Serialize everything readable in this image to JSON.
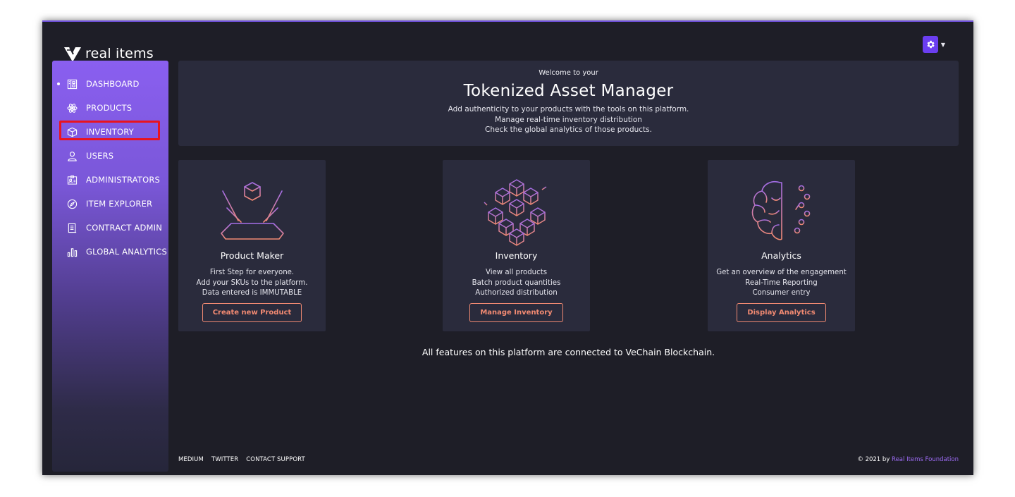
{
  "brand": {
    "name": "real items"
  },
  "sidebar": {
    "items": [
      {
        "label": "DASHBOARD",
        "icon": "dashboard-icon",
        "active": true
      },
      {
        "label": "PRODUCTS",
        "icon": "atom-icon"
      },
      {
        "label": "INVENTORY",
        "icon": "box-icon",
        "highlighted": true
      },
      {
        "label": "USERS",
        "icon": "user-icon"
      },
      {
        "label": "ADMINISTRATORS",
        "icon": "id-card-icon"
      },
      {
        "label": "ITEM EXPLORER",
        "icon": "compass-icon"
      },
      {
        "label": "CONTRACT ADMIN",
        "icon": "document-icon"
      },
      {
        "label": "GLOBAL ANALYTICS",
        "icon": "bar-chart-icon"
      }
    ]
  },
  "welcome": {
    "eyebrow": "Welcome to your",
    "title": "Tokenized Asset Manager",
    "lines": [
      "Add authenticity to your products with the tools on this platform.",
      "Manage real-time inventory distribution",
      "Check the global analytics of those products."
    ]
  },
  "cards": [
    {
      "title": "Product Maker",
      "icon": "hologram-cube-icon",
      "lines": [
        "First Step for everyone.",
        "Add your SKUs to the platform.",
        "Data entered is IMMUTABLE"
      ],
      "button": "Create new Product"
    },
    {
      "title": "Inventory",
      "icon": "cubes-network-icon",
      "lines": [
        "View all products",
        "Batch product quantities",
        "Authorized distribution"
      ],
      "button": "Manage Inventory"
    },
    {
      "title": "Analytics",
      "icon": "brain-circuit-icon",
      "lines": [
        "Get an overview of the engagement",
        "Real-Time Reporting",
        "Consumer entry"
      ],
      "button": "Display Analytics"
    }
  ],
  "blockchain_note": "All features on this platform are connected to VeChain Blockchain.",
  "footer": {
    "links": [
      "MEDIUM",
      "TWITTER",
      "CONTACT SUPPORT"
    ],
    "copyright_prefix": "© 2021 by",
    "copyright_link": "Real Items Foundation"
  },
  "colors": {
    "accent": "#6b3ef0",
    "highlight": "#e8141f",
    "button": "#f28a72",
    "panel": "#2a2b3c",
    "background": "#1e1e27"
  }
}
